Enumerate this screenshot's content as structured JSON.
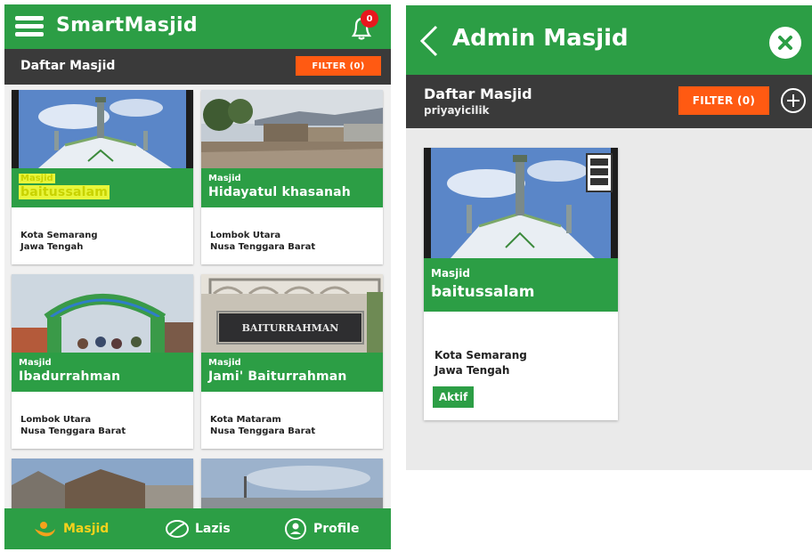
{
  "left_app": {
    "app_title": "SmartMasjid",
    "notification_count": "0",
    "section_title": "Daftar Masjid",
    "filter_label": "FILTER (0)",
    "cards": [
      {
        "type_label": "Masjid",
        "name": "baitussalam",
        "city": "Kota Semarang",
        "province": "Jawa Tengah"
      },
      {
        "type_label": "Masjid",
        "name": "Hidayatul khasanah",
        "city": "Lombok Utara",
        "province": "Nusa Tenggara Barat"
      },
      {
        "type_label": "Masjid",
        "name": "Ibadurrahman",
        "city": "Lombok Utara",
        "province": "Nusa Tenggara Barat"
      },
      {
        "type_label": "Masjid",
        "name": "Jami' Baiturrahman",
        "city": "Kota Mataram",
        "province": "Nusa Tenggara Barat"
      }
    ],
    "nav": [
      {
        "label": "Masjid",
        "icon": "mosque-icon",
        "active": true
      },
      {
        "label": "Lazis",
        "icon": "leaf-icon",
        "active": false
      },
      {
        "label": "Profile",
        "icon": "profile-icon",
        "active": false
      }
    ]
  },
  "right_app": {
    "title": "Admin Masjid",
    "section_title": "Daftar Masjid",
    "username": "priyayicilik",
    "filter_label": "FILTER (0)",
    "card": {
      "type_label": "Masjid",
      "name": "baitussalam",
      "city": "Kota Semarang",
      "province": "Jawa Tengah",
      "status": "Aktif"
    }
  },
  "colors": {
    "primary_green": "#2c9e45",
    "dark_bar": "#3a3a3a",
    "filter_orange": "#ff5a12",
    "active_nav": "#f6d21c",
    "badge_red": "#e8171d"
  }
}
